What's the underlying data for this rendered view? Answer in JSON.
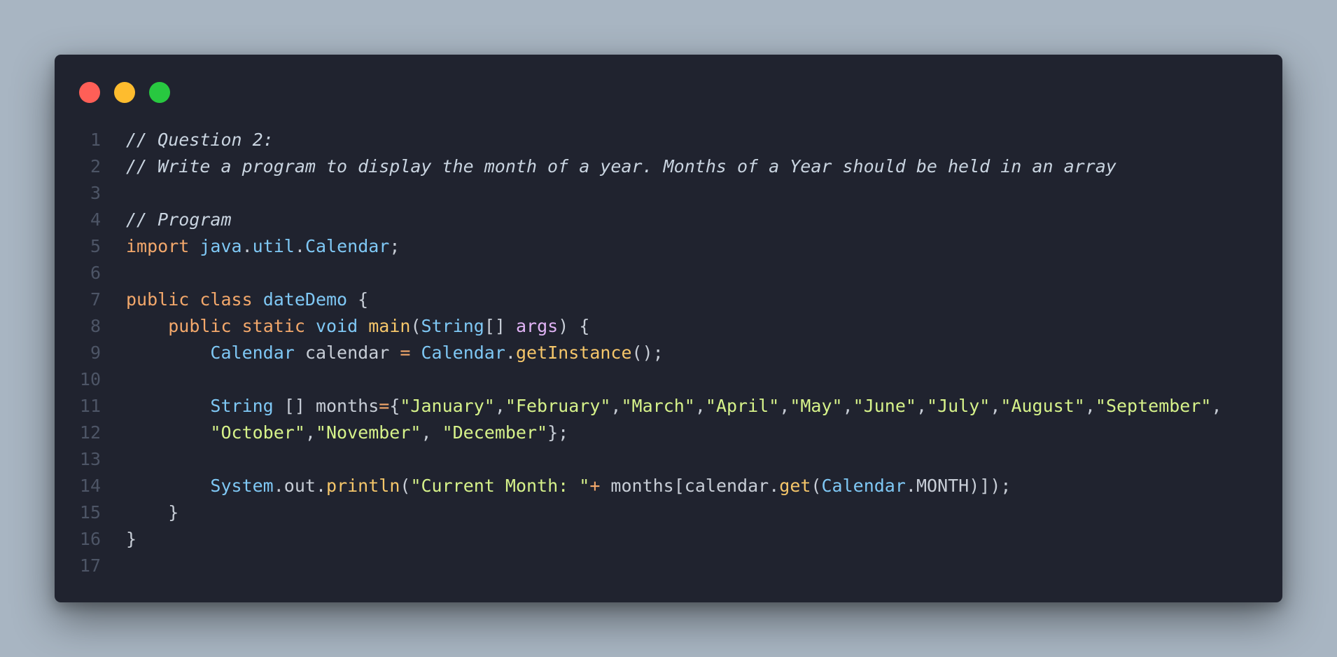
{
  "window": {
    "buttons": [
      {
        "name": "close",
        "color": "#ff5f57"
      },
      {
        "name": "minimize",
        "color": "#febc2e"
      },
      {
        "name": "maximize",
        "color": "#28c840"
      }
    ]
  },
  "code": {
    "lines": [
      {
        "n": "1",
        "tokens": [
          {
            "t": "// Question 2:",
            "c": "comment"
          }
        ]
      },
      {
        "n": "2",
        "tokens": [
          {
            "t": "// Write a program to display the month of a year. Months of a Year should be held in an array",
            "c": "comment"
          }
        ]
      },
      {
        "n": "3",
        "tokens": []
      },
      {
        "n": "4",
        "tokens": [
          {
            "t": "// Program",
            "c": "comment"
          }
        ]
      },
      {
        "n": "5",
        "tokens": [
          {
            "t": "import",
            "c": "kw"
          },
          {
            "t": " ",
            "c": "plain"
          },
          {
            "t": "java",
            "c": "type"
          },
          {
            "t": ".",
            "c": "punc"
          },
          {
            "t": "util",
            "c": "type"
          },
          {
            "t": ".",
            "c": "punc"
          },
          {
            "t": "Calendar",
            "c": "type"
          },
          {
            "t": ";",
            "c": "punc"
          }
        ]
      },
      {
        "n": "6",
        "tokens": []
      },
      {
        "n": "7",
        "tokens": [
          {
            "t": "public",
            "c": "kw"
          },
          {
            "t": " ",
            "c": "plain"
          },
          {
            "t": "class",
            "c": "kw"
          },
          {
            "t": " ",
            "c": "plain"
          },
          {
            "t": "dateDemo",
            "c": "type"
          },
          {
            "t": " {",
            "c": "punc"
          }
        ]
      },
      {
        "n": "8",
        "tokens": [
          {
            "t": "    ",
            "c": "plain"
          },
          {
            "t": "public",
            "c": "kw"
          },
          {
            "t": " ",
            "c": "plain"
          },
          {
            "t": "static",
            "c": "kw"
          },
          {
            "t": " ",
            "c": "plain"
          },
          {
            "t": "void",
            "c": "type"
          },
          {
            "t": " ",
            "c": "plain"
          },
          {
            "t": "main",
            "c": "fn"
          },
          {
            "t": "(",
            "c": "punc"
          },
          {
            "t": "String",
            "c": "type"
          },
          {
            "t": "[] ",
            "c": "punc"
          },
          {
            "t": "args",
            "c": "param"
          },
          {
            "t": ") {",
            "c": "punc"
          }
        ]
      },
      {
        "n": "9",
        "tokens": [
          {
            "t": "        ",
            "c": "plain"
          },
          {
            "t": "Calendar",
            "c": "type"
          },
          {
            "t": " calendar ",
            "c": "plain"
          },
          {
            "t": "=",
            "c": "op"
          },
          {
            "t": " ",
            "c": "plain"
          },
          {
            "t": "Calendar",
            "c": "type"
          },
          {
            "t": ".",
            "c": "punc"
          },
          {
            "t": "getInstance",
            "c": "fn"
          },
          {
            "t": "();",
            "c": "punc"
          }
        ]
      },
      {
        "n": "10",
        "tokens": []
      },
      {
        "n": "11",
        "tokens": [
          {
            "t": "        ",
            "c": "plain"
          },
          {
            "t": "String",
            "c": "type"
          },
          {
            "t": " [] months",
            "c": "plain"
          },
          {
            "t": "=",
            "c": "op"
          },
          {
            "t": "{",
            "c": "punc"
          },
          {
            "t": "\"January\"",
            "c": "str"
          },
          {
            "t": ",",
            "c": "punc"
          },
          {
            "t": "\"February\"",
            "c": "str"
          },
          {
            "t": ",",
            "c": "punc"
          },
          {
            "t": "\"March\"",
            "c": "str"
          },
          {
            "t": ",",
            "c": "punc"
          },
          {
            "t": "\"April\"",
            "c": "str"
          },
          {
            "t": ",",
            "c": "punc"
          },
          {
            "t": "\"May\"",
            "c": "str"
          },
          {
            "t": ",",
            "c": "punc"
          },
          {
            "t": "\"June\"",
            "c": "str"
          },
          {
            "t": ",",
            "c": "punc"
          },
          {
            "t": "\"July\"",
            "c": "str"
          },
          {
            "t": ",",
            "c": "punc"
          },
          {
            "t": "\"August\"",
            "c": "str"
          },
          {
            "t": ",",
            "c": "punc"
          },
          {
            "t": "\"September\"",
            "c": "str"
          },
          {
            "t": ",",
            "c": "punc"
          }
        ]
      },
      {
        "n": "12",
        "tokens": [
          {
            "t": "        ",
            "c": "plain"
          },
          {
            "t": "\"October\"",
            "c": "str"
          },
          {
            "t": ",",
            "c": "punc"
          },
          {
            "t": "\"November\"",
            "c": "str"
          },
          {
            "t": ", ",
            "c": "punc"
          },
          {
            "t": "\"December\"",
            "c": "str"
          },
          {
            "t": "};",
            "c": "punc"
          }
        ]
      },
      {
        "n": "13",
        "tokens": []
      },
      {
        "n": "14",
        "tokens": [
          {
            "t": "        ",
            "c": "plain"
          },
          {
            "t": "System",
            "c": "type"
          },
          {
            "t": ".",
            "c": "punc"
          },
          {
            "t": "out",
            "c": "plain"
          },
          {
            "t": ".",
            "c": "punc"
          },
          {
            "t": "println",
            "c": "fn"
          },
          {
            "t": "(",
            "c": "punc"
          },
          {
            "t": "\"Current Month: \"",
            "c": "str"
          },
          {
            "t": "+",
            "c": "op"
          },
          {
            "t": " months[calendar",
            "c": "plain"
          },
          {
            "t": ".",
            "c": "punc"
          },
          {
            "t": "get",
            "c": "fn"
          },
          {
            "t": "(",
            "c": "punc"
          },
          {
            "t": "Calendar",
            "c": "type"
          },
          {
            "t": ".",
            "c": "punc"
          },
          {
            "t": "MONTH",
            "c": "plain"
          },
          {
            "t": ")]);",
            "c": "punc"
          }
        ]
      },
      {
        "n": "15",
        "tokens": [
          {
            "t": "    }",
            "c": "punc"
          }
        ]
      },
      {
        "n": "16",
        "tokens": [
          {
            "t": "}",
            "c": "punc"
          }
        ]
      },
      {
        "n": "17",
        "tokens": []
      }
    ]
  }
}
